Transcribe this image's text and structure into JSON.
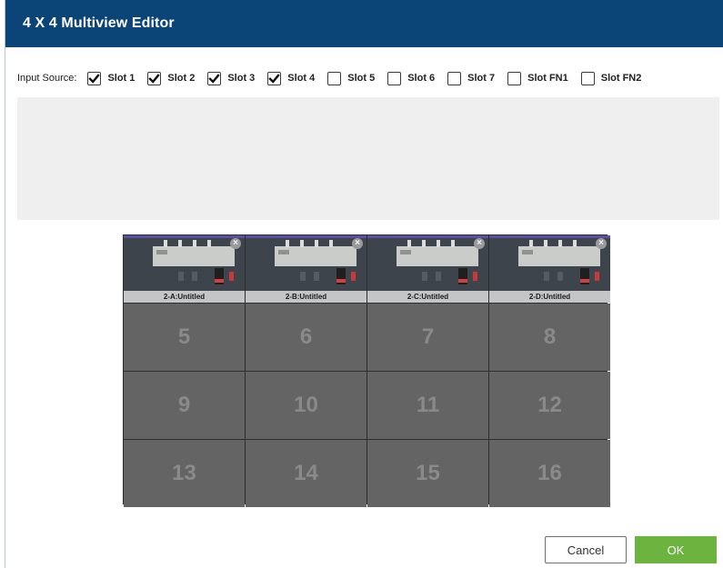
{
  "dialog": {
    "title": "4 X 4 Multiview Editor"
  },
  "input_source": {
    "label": "Input Source:",
    "slots": [
      {
        "label": "Slot 1",
        "checked": true
      },
      {
        "label": "Slot 2",
        "checked": true
      },
      {
        "label": "Slot 3",
        "checked": true
      },
      {
        "label": "Slot 4",
        "checked": true
      },
      {
        "label": "Slot 5",
        "checked": false
      },
      {
        "label": "Slot 6",
        "checked": false
      },
      {
        "label": "Slot 7",
        "checked": false
      },
      {
        "label": "Slot FN1",
        "checked": false
      },
      {
        "label": "Slot FN2",
        "checked": false
      }
    ]
  },
  "grid": {
    "video_cells": [
      {
        "label": "2-A:Untitled",
        "close": "×"
      },
      {
        "label": "2-B:Untitled",
        "close": "×"
      },
      {
        "label": "2-C:Untitled",
        "close": "×"
      },
      {
        "label": "2-D:Untitled",
        "close": "×"
      }
    ],
    "empty_cells": [
      "5",
      "6",
      "7",
      "8",
      "9",
      "10",
      "11",
      "12",
      "13",
      "14",
      "15",
      "16"
    ]
  },
  "buttons": {
    "cancel": "Cancel",
    "ok": "OK"
  },
  "colors": {
    "titlebar": "#0b4577",
    "ok_button": "#6cb33f",
    "grid_cell": "#646464"
  }
}
